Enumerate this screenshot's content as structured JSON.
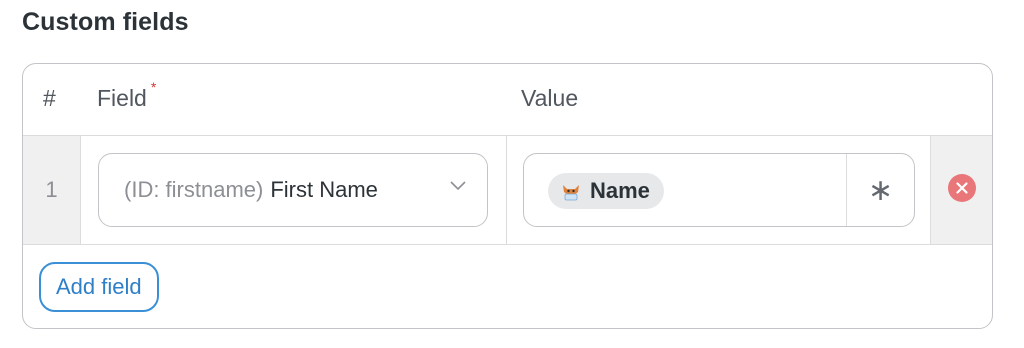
{
  "section": {
    "title": "Custom fields"
  },
  "table": {
    "headers": {
      "number": "#",
      "field": "Field",
      "required_mark": "*",
      "value": "Value"
    },
    "rows": [
      {
        "number": "1",
        "field": {
          "id_label": "(ID: firstname)",
          "name": "First Name"
        },
        "value": {
          "tag_label": "Name",
          "tag_icon": "fox-mascot-icon",
          "smart_tag_symbol": "∗"
        }
      }
    ]
  },
  "actions": {
    "add_field_label": "Add field"
  },
  "colors": {
    "remove": "#e9777a",
    "add_field": "#2f7fc8",
    "required": "#d63638"
  }
}
